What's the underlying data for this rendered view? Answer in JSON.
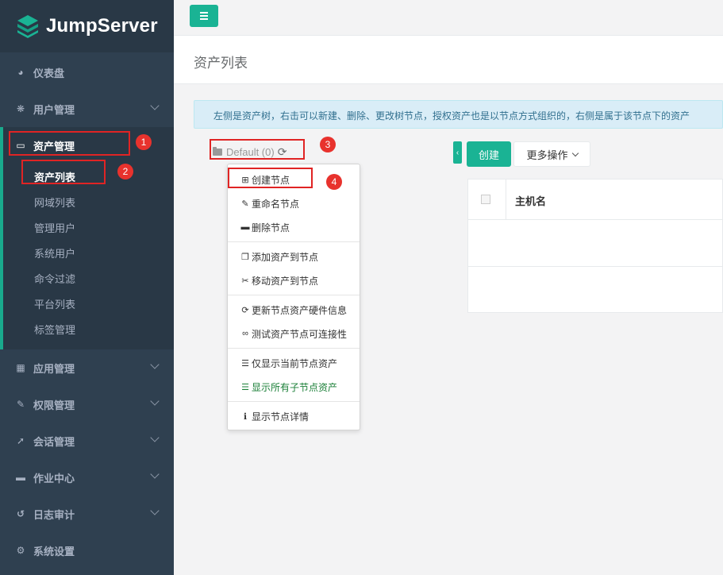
{
  "app": {
    "name": "JumpServer"
  },
  "sidebar": {
    "items_top": [
      {
        "label": "仪表盘",
        "icon": "dashboard-icon"
      },
      {
        "label": "用户管理",
        "icon": "users-icon"
      }
    ],
    "asset_group": {
      "label": "资产管理",
      "icon": "inbox-icon",
      "sub_items": [
        "资产列表",
        "网域列表",
        "管理用户",
        "系统用户",
        "命令过滤",
        "平台列表",
        "标签管理"
      ]
    },
    "items_bottom": [
      {
        "label": "应用管理",
        "icon": "apps-grid-icon"
      },
      {
        "label": "权限管理",
        "icon": "edit-icon"
      },
      {
        "label": "会话管理",
        "icon": "rocket-icon"
      },
      {
        "label": "作业中心",
        "icon": "monitor-icon"
      },
      {
        "label": "日志审计",
        "icon": "history-icon"
      },
      {
        "label": "系统设置",
        "icon": "gears-icon"
      }
    ]
  },
  "page": {
    "title": "资产列表",
    "alert": "左侧是资产树，右击可以新建、删除、更改树节点，授权资产也是以节点方式组织的，右侧是属于该节点下的资产"
  },
  "tree": {
    "root_label": "Default (0)"
  },
  "context_menu": {
    "items": [
      {
        "label": "创建节点",
        "icon": "plus-square-icon",
        "glyph": "⊞"
      },
      {
        "label": "重命名节点",
        "icon": "edit-icon",
        "glyph": "✎"
      },
      {
        "label": "删除节点",
        "icon": "minus-square-icon",
        "glyph": "▬"
      },
      {
        "label": "添加资产到节点",
        "icon": "copy-icon",
        "glyph": "❐"
      },
      {
        "label": "移动资产到节点",
        "icon": "scissors-icon",
        "glyph": "✂"
      },
      {
        "label": "更新节点资产硬件信息",
        "icon": "refresh-icon",
        "glyph": "⟳"
      },
      {
        "label": "测试资产节点可连接性",
        "icon": "link-icon",
        "glyph": "∞"
      },
      {
        "label": "仅显示当前节点资产",
        "icon": "indent-icon",
        "glyph": "☰"
      },
      {
        "label": "显示所有子节点资产",
        "icon": "list-icon",
        "glyph": "☰"
      },
      {
        "label": "显示节点详情",
        "icon": "info-circle-icon",
        "glyph": "ℹ"
      }
    ]
  },
  "toolbar": {
    "create_label": "创建",
    "more_label": "更多操作"
  },
  "table": {
    "headers": [
      "主机名"
    ]
  },
  "annotations": [
    "1",
    "2",
    "3",
    "4"
  ],
  "colors": {
    "sidebar_bg": "#2f4050",
    "accent": "#1ab394",
    "annotation_red": "#e02424"
  }
}
